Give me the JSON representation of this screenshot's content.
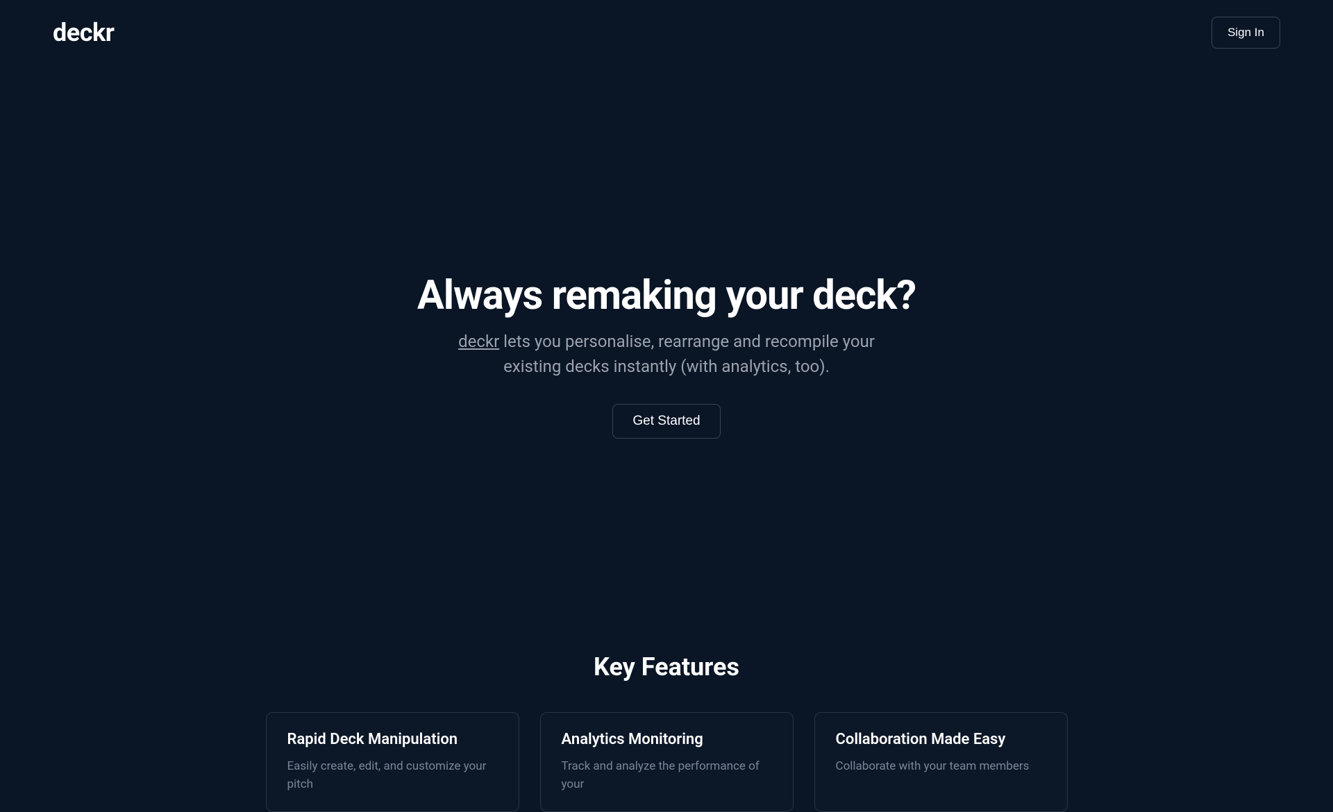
{
  "header": {
    "logo": "deckr",
    "sign_in_label": "Sign In"
  },
  "hero": {
    "title": "Always remaking your deck?",
    "subtitle_brand": "deckr",
    "subtitle_text": " lets you personalise, rearrange and recompile your existing decks instantly (with analytics, too).",
    "cta_label": "Get Started"
  },
  "features": {
    "section_title": "Key Features",
    "cards": [
      {
        "title": "Rapid Deck Manipulation",
        "desc": "Easily create, edit, and customize your pitch"
      },
      {
        "title": "Analytics Monitoring",
        "desc": "Track and analyze the performance of your"
      },
      {
        "title": "Collaboration Made Easy",
        "desc": "Collaborate with your team members"
      }
    ]
  }
}
